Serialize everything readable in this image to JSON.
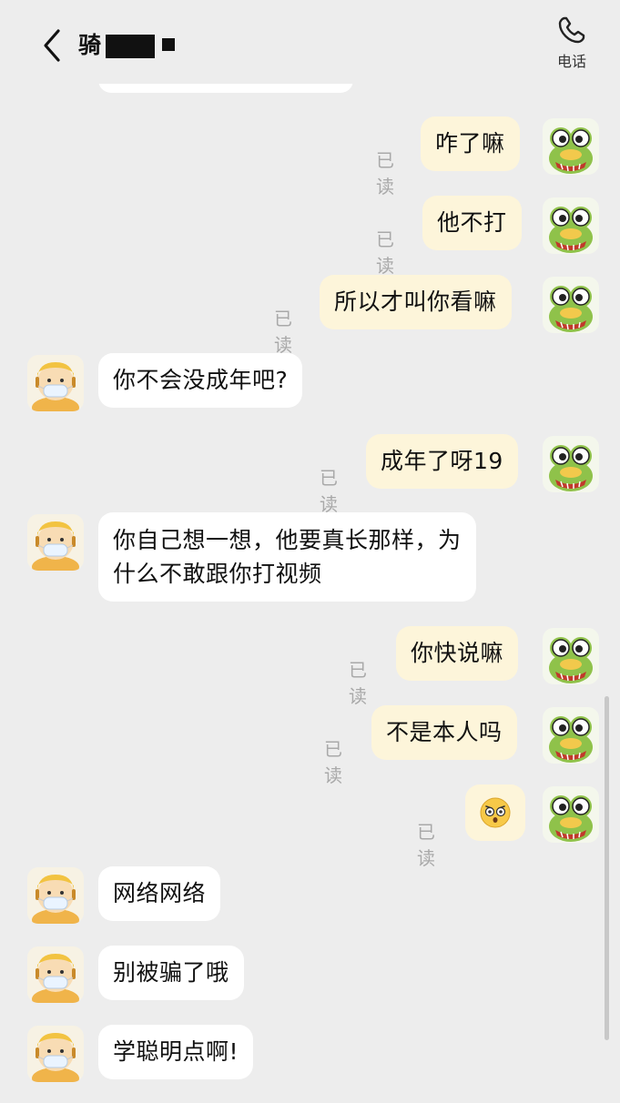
{
  "header": {
    "title": "骑",
    "call_label": "电话"
  },
  "read_label": "已读",
  "messages": [
    {
      "side": "me",
      "text": "咋了嘛",
      "read": true
    },
    {
      "side": "me",
      "text": "他不打",
      "read": true
    },
    {
      "side": "me",
      "text": "所以才叫你看嘛",
      "read": true
    },
    {
      "side": "them",
      "text": "你不会没成年吧?"
    },
    {
      "side": "me",
      "text": "成年了呀19",
      "read": true
    },
    {
      "side": "them",
      "text": "你自己想一想，他要真长那样，为",
      "text2": "什么不敢跟你打视频"
    },
    {
      "side": "me",
      "text": "你快说嘛",
      "read": true
    },
    {
      "side": "me",
      "text": "不是本人吗",
      "read": true
    },
    {
      "side": "me",
      "emoji": "shocked-face-emoji",
      "read": true
    },
    {
      "side": "them",
      "text": "网络网络"
    },
    {
      "side": "them",
      "text": "别被骗了哦"
    },
    {
      "side": "them",
      "text": "学聪明点啊!"
    }
  ],
  "colors": {
    "background": "#ededed",
    "my_bubble": "#fdf5da",
    "their_bubble": "#ffffff",
    "read_text": "#a9a9a9"
  }
}
